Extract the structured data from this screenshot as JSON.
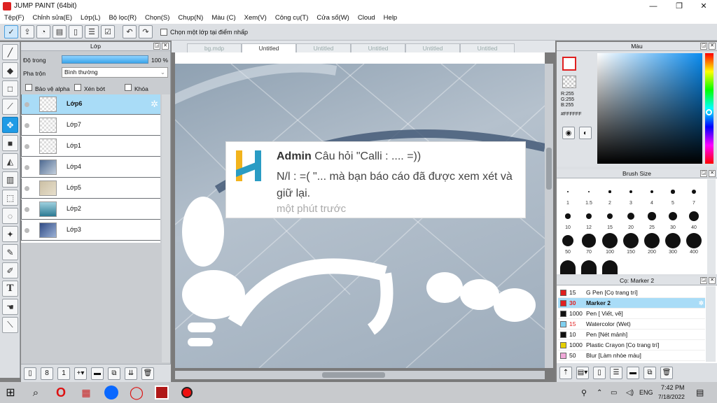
{
  "window": {
    "title": "JUMP PAINT (64bit)",
    "controls": [
      "—",
      "❐",
      "✕"
    ]
  },
  "menu": [
    "Tệp(F)",
    "Chỉnh sửa(E)",
    "Lớp(L)",
    "Bộ lọc(R)",
    "Chọn(S)",
    "Chụp(N)",
    "Màu (C)",
    "Xem(V)",
    "Công cụ(T)",
    "Cửa sổ(W)",
    "Cloud",
    "Help"
  ],
  "toolbar": {
    "checkbox_label": "Chọn một lớp tại điểm nhấp"
  },
  "layer_panel": {
    "title": "Lớp",
    "opacity_label": "Độ trong",
    "opacity_value": "100 %",
    "opacity_fraction": 1.0,
    "blend_label": "Pha trộn",
    "blend_value": "Bình thường",
    "protect_alpha": "Bảo vệ alpha",
    "clipping": "Xén bớt",
    "lock": "Khóa",
    "layers": [
      "Lớp6",
      "Lớp7",
      "Lớp1",
      "Lớp4",
      "Lớp5",
      "Lớp2",
      "Lớp3"
    ],
    "selected_index": 0
  },
  "tabs": [
    "bg.mdp",
    "Untitled",
    "Untitled",
    "Untitled",
    "Untitled",
    "Untitled"
  ],
  "active_tab": 1,
  "notification": {
    "author": "Admin",
    "line1": "Câu hỏi \"Calli : .... =))",
    "line2": "N/l : =( \"... mà bạn báo cáo đã được xem xét và giữ lại.",
    "time": "một phút trước"
  },
  "color_panel": {
    "title": "Màu",
    "r": "R:255",
    "g": "G:255",
    "b": "B:255",
    "hex": "#FFFFFF",
    "accent": "#0a8cf0"
  },
  "brush_panel": {
    "title": "Brush Size",
    "sizes": [
      "1",
      "1.5",
      "2",
      "3",
      "4",
      "5",
      "7",
      "10",
      "12",
      "15",
      "20",
      "25",
      "30",
      "40",
      "50",
      "70",
      "100",
      "150",
      "200",
      "300",
      "400"
    ]
  },
  "pen_panel": {
    "title": "Cọ: Marker 2",
    "pens": [
      {
        "size": "15",
        "name": "G Pen [Cọ trang trí]",
        "color": "#e02020"
      },
      {
        "size": "30",
        "name": "Marker 2",
        "color": "#e02020"
      },
      {
        "size": "1000",
        "name": "Pen [ Viết, vẽ]",
        "color": "#111111"
      },
      {
        "size": "15",
        "name": "Watercolor (Wet)",
        "color": "#7fd0f0"
      },
      {
        "size": "10",
        "name": "Pen [Nét mảnh]",
        "color": "#111111"
      },
      {
        "size": "1000",
        "name": "Plastic Crayon [Cọ trang trí]",
        "color": "#e6d000"
      },
      {
        "size": "50",
        "name": "Blur [Làm nhòe màu]",
        "color": "#f0a8d8"
      }
    ],
    "selected_index": 1
  },
  "taskbar": {
    "time": "7:42 PM",
    "date": "7/18/2022",
    "lang": "ENG"
  }
}
